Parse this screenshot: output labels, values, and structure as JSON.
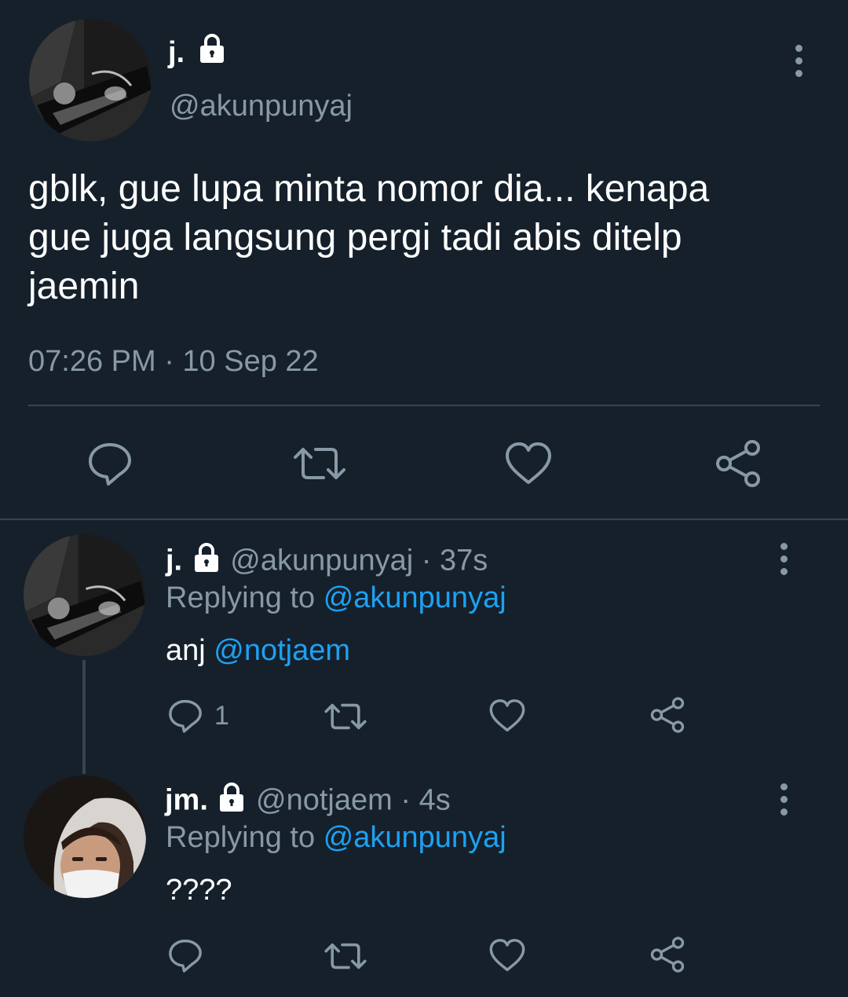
{
  "main_tweet": {
    "display_name": "j.",
    "handle": "@akunpunyaj",
    "text_line1": "gblk, gue lupa minta nomor dia... kenapa",
    "text_line2": "gue juga langsung pergi tadi abis ditelp",
    "text_line3": "jaemin",
    "timestamp": "07:26 PM · 10 Sep 22",
    "actions": [
      "reply-icon",
      "retweet-icon",
      "like-icon",
      "share-icon"
    ]
  },
  "replies": [
    {
      "display_name": "j.",
      "handle": "@akunpunyaj",
      "sep": "·",
      "time": "37s",
      "replying_prefix": "Replying to",
      "replying_to": "@akunpunyaj",
      "text": "anj",
      "mention": "@notjaem",
      "reply_count": "1"
    },
    {
      "display_name": "jm.",
      "handle": "@notjaem",
      "sep": "·",
      "time": "4s",
      "replying_prefix": "Replying to",
      "replying_to": "@akunpunyaj",
      "text": "????",
      "reply_count": ""
    }
  ],
  "colors": {
    "background": "#15202b",
    "muted": "#8899a6",
    "link": "#1da1f2",
    "divider": "#38444d"
  }
}
